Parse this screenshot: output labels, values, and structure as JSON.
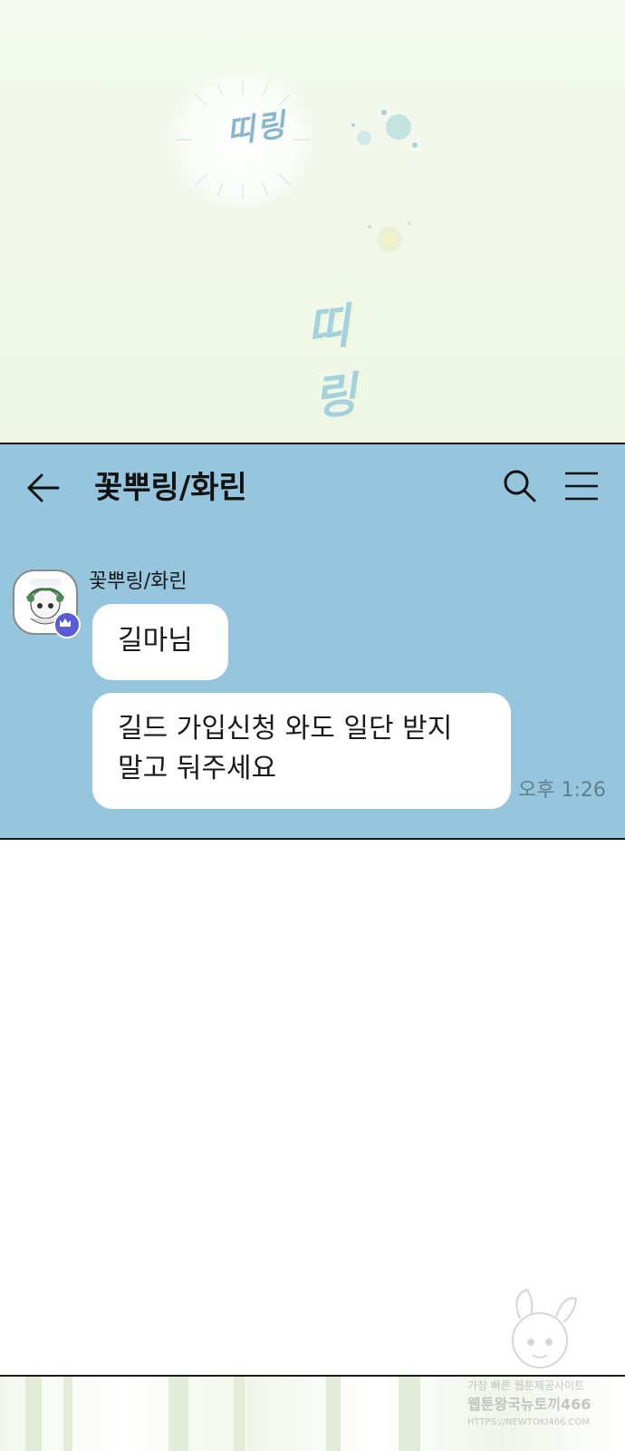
{
  "comic": {
    "sfx_top": "띠링",
    "sfx_bottom": "띠링"
  },
  "chat": {
    "title": "꽃뿌링/화린",
    "icons": {
      "back": "arrow-left-icon",
      "search": "search-icon",
      "menu": "hamburger-menu-icon"
    },
    "message_group": {
      "sender": "꽃뿌링/화린",
      "avatar_badge": "crown-icon",
      "messages": [
        {
          "text": "길마님"
        },
        {
          "line1": "길드 가입신청 와도 일단 받지",
          "line2": "말고 둬주세요"
        }
      ],
      "time": "오후 1:26"
    },
    "colors": {
      "background": "#96c6dd",
      "bubble": "#ffffff",
      "badge": "#5b5bd8"
    }
  },
  "watermark": {
    "line1": "가장 빠른 웹툰제공사이트",
    "line2": "웹툰왕국뉴토끼466",
    "line3": "HTTPS://NEWTOKI466.COM"
  }
}
